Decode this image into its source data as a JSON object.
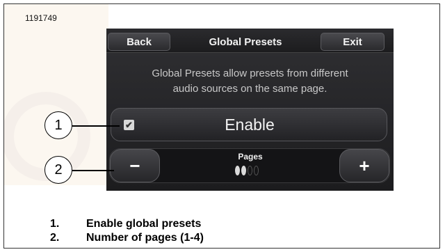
{
  "figure_id": "1191749",
  "screen": {
    "back_label": "Back",
    "title": "Global Presets",
    "exit_label": "Exit",
    "description_line1": "Global Presets allow presets from different",
    "description_line2": "audio sources on the same page.",
    "enable": {
      "label": "Enable",
      "checked": true
    },
    "pages": {
      "label": "Pages",
      "minus_label": "−",
      "plus_label": "+",
      "current": 2,
      "total": 4
    }
  },
  "callouts": {
    "one": "1",
    "two": "2"
  },
  "legend": [
    {
      "number": "1.",
      "text": "Enable global presets"
    },
    {
      "number": "2.",
      "text": "Number of pages (1-4)"
    }
  ],
  "colors": {
    "screen_bg": "#252528",
    "button_face": "#3d3d41",
    "text_light": "#f2f2f2"
  }
}
